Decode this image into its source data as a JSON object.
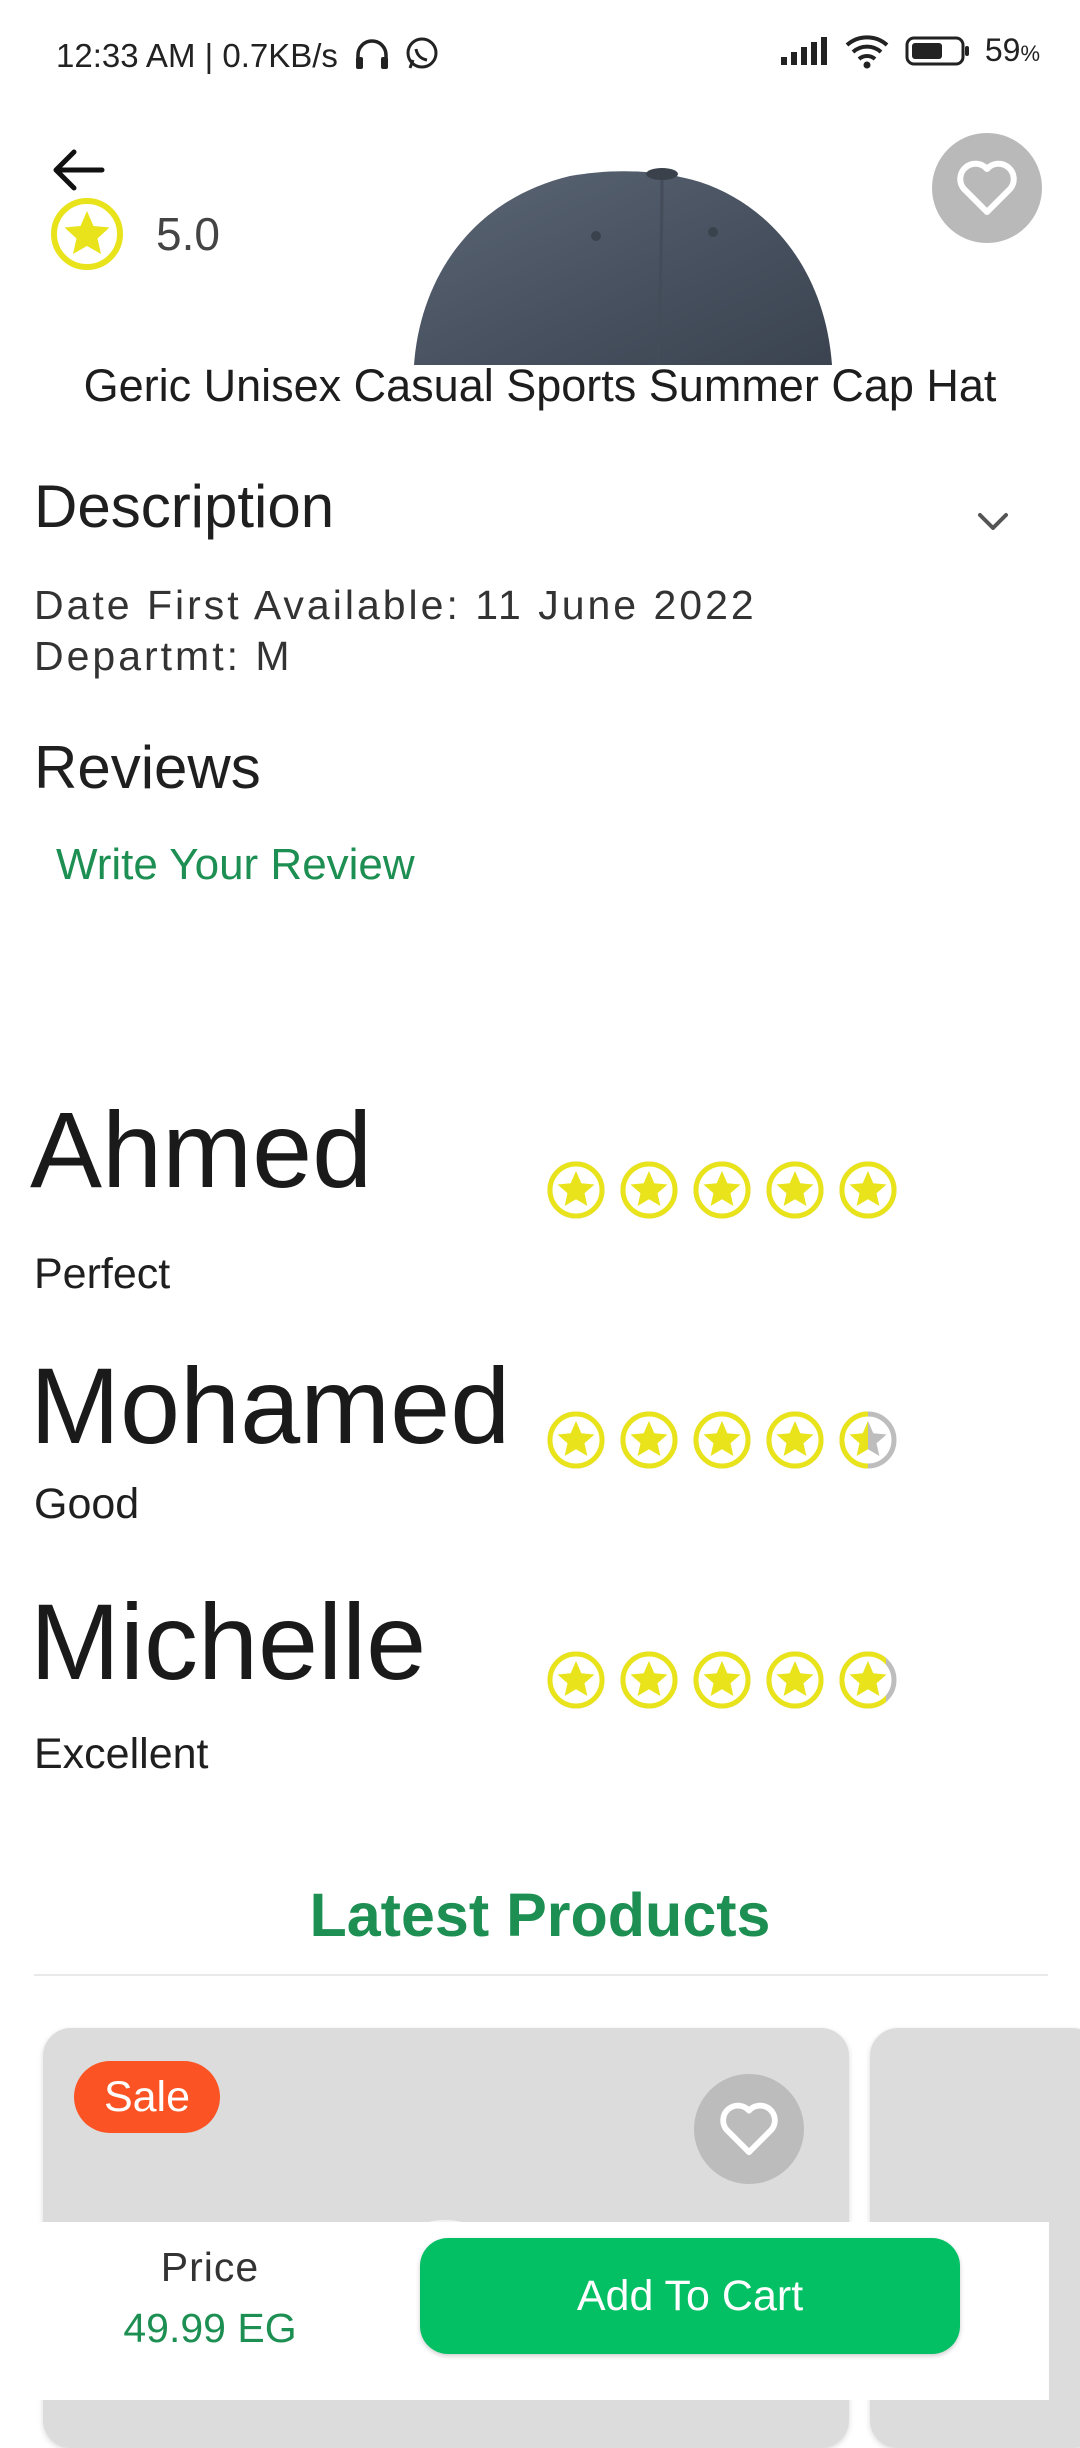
{
  "status_bar": {
    "time_speed": "12:33 AM | 0.7KB/s",
    "battery_percent": "59",
    "percent_sign": "%",
    "icons": [
      "headphones-icon",
      "whatsapp-icon",
      "signal-icon",
      "wifi-icon",
      "battery-icon"
    ]
  },
  "product": {
    "rating": "5.0",
    "title": "Geric Unisex Casual Sports Summer Cap Hat",
    "image": "cap-image"
  },
  "description": {
    "heading": "Description",
    "line1": "Date First Available: 11 June 2022",
    "line2": "Departmt: M"
  },
  "reviews": {
    "heading": "Reviews",
    "write_label": "Write Your Review",
    "items": [
      {
        "name": "Ahmed",
        "comment": "Perfect",
        "rating": 5.0
      },
      {
        "name": "Mohamed",
        "comment": "Good",
        "rating": 4.5
      },
      {
        "name": "Michelle",
        "comment": "Excellent",
        "rating": 4.8
      }
    ]
  },
  "latest": {
    "heading": "Latest Products",
    "sale_badge": "Sale"
  },
  "cart_bar": {
    "price_label": "Price",
    "price_value": "49.99 EG",
    "add_to_cart": "Add To Cart"
  },
  "colors": {
    "accent_green": "#1d8f52",
    "button_green": "#04c065",
    "star_yellow": "#e9e31b",
    "sale_orange": "#fb5323",
    "favorite_bg": "#b9b9b9"
  }
}
